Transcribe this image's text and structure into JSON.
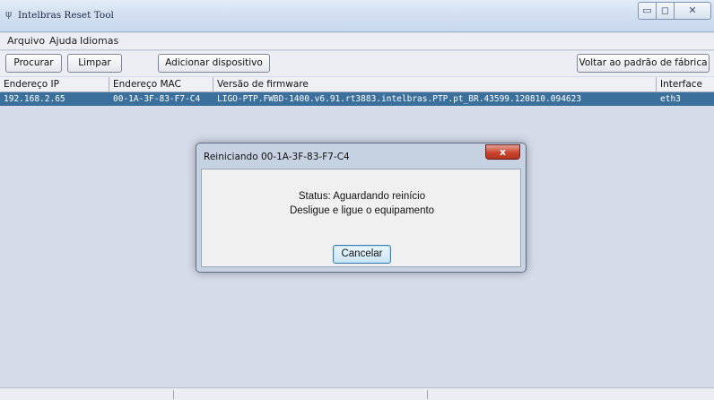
{
  "window": {
    "title": "Intelbras  Reset Tool",
    "icon": "antenna-icon",
    "controls": {
      "minimize": "▭",
      "maximize": "◻",
      "close": "✕"
    }
  },
  "menu": {
    "items": [
      "Arquivo",
      "Ajuda",
      "Idiomas"
    ]
  },
  "toolbar": {
    "search_label": "Procurar",
    "clear_label": "Limpar",
    "add_device_label": "Adicionar dispositivo",
    "factory_reset_label": "Voltar ao padrão de fábrica"
  },
  "table": {
    "columns": [
      "Endereço IP",
      "Endereço MAC",
      "Versão de firmware",
      "Interface"
    ],
    "rows": [
      {
        "ip": "192.168.2.65",
        "mac": "00-1A-3F-83-F7-C4",
        "firmware": "LIGO-PTP.FWBD-1400.v6.91.rt3883.intelbras.PTP.pt_BR.43599.120810.094623",
        "interface": "eth3",
        "selected": true
      }
    ]
  },
  "dialog": {
    "title": "Reiniciando 00-1A-3F-83-F7-C4",
    "close_glyph": "x",
    "status_line": "Status: Aguardando reinício",
    "instruction_line": "Desligue e ligue o equipamento",
    "cancel_label": "Cancelar"
  },
  "colors": {
    "selection": "#3b6f9c",
    "background": "#d6dbe9",
    "close_button": "#c9442e"
  }
}
